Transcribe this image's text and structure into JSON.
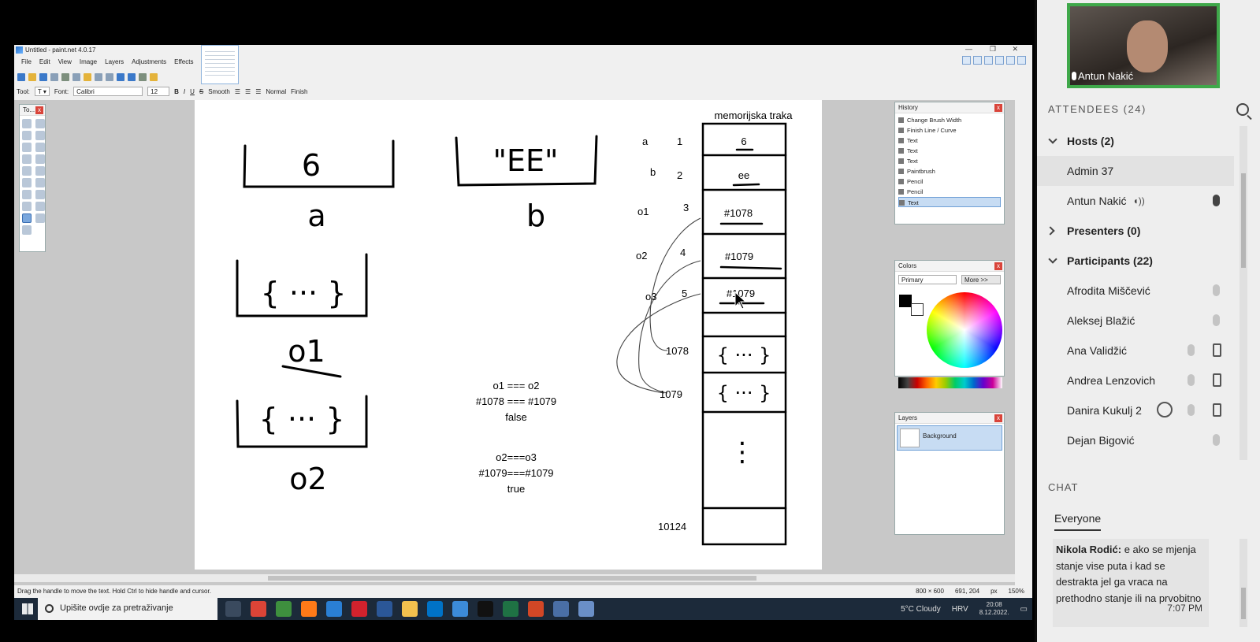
{
  "app": {
    "title": "Untitled - paint.net 4.0.17",
    "menu": [
      "File",
      "Edit",
      "View",
      "Image",
      "Layers",
      "Adjustments",
      "Effects"
    ],
    "tool_label": "Tool:",
    "font_label": "Font:",
    "font_value": "Calibri",
    "font_size": "12",
    "smoothing": "Smooth",
    "blend_mode": "Normal",
    "finish": "Finish"
  },
  "canvas": {
    "box_a_value": "6",
    "box_a_name": "a",
    "box_b_value": "\"EE\"",
    "box_b_name": "b",
    "obj1_content": "{ ··· }",
    "obj1_name": "o1",
    "obj2_content": "{ ··· }",
    "obj2_name": "o2",
    "compare1": [
      "o1 === o2",
      "#1078 === #1079",
      "false"
    ],
    "compare2": [
      "o2===o3",
      "#1079===#1079",
      "true"
    ],
    "tape_title": "memorijska traka",
    "tape_rows": [
      {
        "var": "a",
        "addr": "1",
        "val": "6"
      },
      {
        "var": "b",
        "addr": "2",
        "val": "ee"
      },
      {
        "var": "o1",
        "addr": "3",
        "val": "#1078"
      },
      {
        "var": "o2",
        "addr": "4",
        "val": "#1079"
      },
      {
        "var": "o3",
        "addr": "5",
        "val": "#1079"
      }
    ],
    "addr_1078": "1078",
    "addr_1079": "1079",
    "heap_obj": "{ ··· }",
    "dots": "⋮",
    "addr_last": "10124"
  },
  "panels": {
    "tools_title": "To...",
    "history_title": "History",
    "history_items": [
      "Change Brush Width",
      "Finish Line / Curve",
      "Text",
      "Text",
      "Text",
      "Paintbrush",
      "Pencil",
      "Pencil",
      "Text"
    ],
    "colors_title": "Colors",
    "colors_mode": "Primary",
    "colors_more": "More >>",
    "layers_title": "Layers",
    "layer_name": "Background"
  },
  "status": {
    "hint": "Drag the handle to move the text. Hold Ctrl to hide handle and cursor.",
    "image_size": "800 × 600",
    "cursor_pos": "691, 204",
    "unit": "px",
    "zoom": "150%"
  },
  "taskbar": {
    "search_placeholder": "Upišite ovdje za pretraživanje",
    "weather": "5°C Cloudy",
    "lang": "HRV",
    "time": "20:08",
    "date": "8.12.2022."
  },
  "video": {
    "name": "Antun Nakić"
  },
  "attendees": {
    "header": "ATTENDEES (24)",
    "hosts_label": "Hosts (2)",
    "hosts": [
      "Admin 37",
      "Antun Nakić"
    ],
    "presenters_label": "Presenters (0)",
    "participants_label": "Participants (22)",
    "participants": [
      "Afrodita Miščević",
      "Aleksej Blažić",
      "Ana Validžić",
      "Andrea Lenzovich",
      "Danira Kukulj 2",
      "Dejan Bigović"
    ]
  },
  "chat": {
    "header": "CHAT",
    "tab": "Everyone",
    "sender": "Nikola Rodić:",
    "message": "e ako se mjenja stanje vise puta i kad se destrakta jel ga vraca na prethodno stanje ili na prvobitno",
    "time": "7:07 PM"
  }
}
